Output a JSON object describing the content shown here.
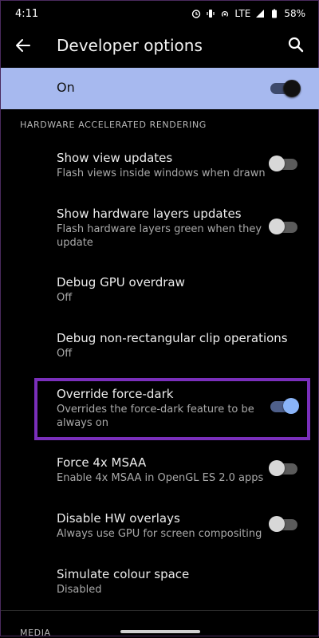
{
  "status_bar": {
    "time": "4:11",
    "network": "LTE",
    "battery": "58%"
  },
  "app_bar": {
    "title": "Developer options"
  },
  "master_switch": {
    "label": "On",
    "state": "on"
  },
  "section_header": "HARDWARE ACCELERATED RENDERING",
  "items": [
    {
      "title": "Show view updates",
      "subtitle": "Flash views inside windows when drawn",
      "switch": "off"
    },
    {
      "title": "Show hardware layers updates",
      "subtitle": "Flash hardware layers green when they update",
      "switch": "off"
    },
    {
      "title": "Debug GPU overdraw",
      "subtitle": "Off"
    },
    {
      "title": "Debug non-rectangular clip operations",
      "subtitle": "Off"
    },
    {
      "title": "Override force-dark",
      "subtitle": "Overrides the force-dark feature to be always on",
      "switch": "on"
    },
    {
      "title": "Force 4x MSAA",
      "subtitle": "Enable 4x MSAA in OpenGL ES 2.0 apps",
      "switch": "off"
    },
    {
      "title": "Disable HW overlays",
      "subtitle": "Always use GPU for screen compositing",
      "switch": "off"
    },
    {
      "title": "Simulate colour space",
      "subtitle": "Disabled"
    }
  ],
  "next_section_header": "MEDIA",
  "colors": {
    "accent": "#8ab4f8",
    "master_bar": "#a7b9ef",
    "highlight_border": "#7a2fbb"
  }
}
